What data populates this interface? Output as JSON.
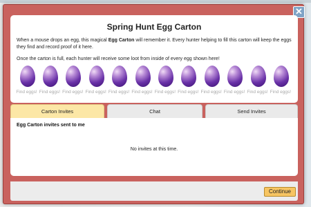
{
  "dialog": {
    "title": "Spring Hunt Egg Carton",
    "desc_part1": "When a mouse drops an egg, this magical ",
    "desc_bold": "Egg Carton",
    "desc_part2": " will remember it. Every hunter helping to fill this carton will keep the eggs they find and record proof of it here.",
    "desc2": "Once the carton is full, each hunter will receive some loot from inside of every egg shown here!",
    "close_label": "✕"
  },
  "eggs": [
    {
      "label": "Find eggs!"
    },
    {
      "label": "Find eggs!"
    },
    {
      "label": "Find eggs!"
    },
    {
      "label": "Find eggs!"
    },
    {
      "label": "Find eggs!"
    },
    {
      "label": "Find eggs!"
    },
    {
      "label": "Find eggs!"
    },
    {
      "label": "Find eggs!"
    },
    {
      "label": "Find eggs!"
    },
    {
      "label": "Find eggs!"
    },
    {
      "label": "Find eggs!"
    },
    {
      "label": "Find eggs!"
    }
  ],
  "tabs": [
    {
      "label": "Carton Invites",
      "active": true
    },
    {
      "label": "Chat",
      "active": false
    },
    {
      "label": "Send Invites",
      "active": false
    }
  ],
  "invites": {
    "title": "Egg Carton invites sent to me",
    "empty": "No invites at this time."
  },
  "footer": {
    "continue_label": "Continue"
  },
  "colors": {
    "frame": "#c9625e",
    "active_tab": "#fce7a6",
    "continue_button": "#f7c562",
    "egg": "#6a32a8"
  }
}
